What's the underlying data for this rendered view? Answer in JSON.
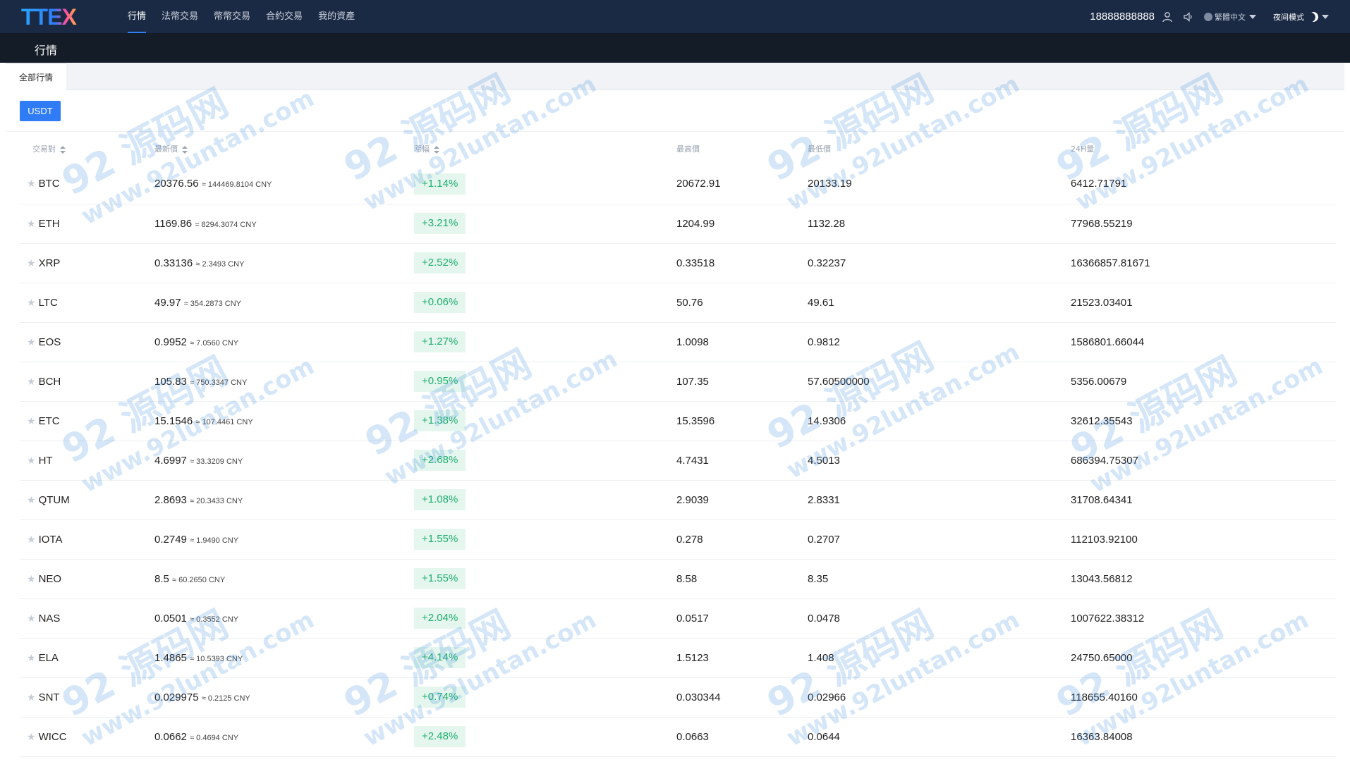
{
  "brand": {
    "logo_text": "TTEX"
  },
  "nav": {
    "items": [
      "行情",
      "法幣交易",
      "幣幣交易",
      "合約交易",
      "我的資產"
    ],
    "active_index": 0
  },
  "header": {
    "phone": "18888888888",
    "language": "繁體中文",
    "night_mode": "夜间模式"
  },
  "page": {
    "title": "行情",
    "tab_label": "全部行情",
    "filter_button": "USDT"
  },
  "table": {
    "headers": [
      "交易對",
      "最新價",
      "漲幅",
      "最高價",
      "最低價",
      "24H量"
    ],
    "rows": [
      {
        "pair": "BTC",
        "price": "20376.56",
        "cny": "≈ 144469.8104 CNY",
        "change": "+1.14%",
        "high": "20672.91",
        "low": "20133.19",
        "volume": "6412.71791"
      },
      {
        "pair": "ETH",
        "price": "1169.86",
        "cny": "≈ 8294.3074 CNY",
        "change": "+3.21%",
        "high": "1204.99",
        "low": "1132.28",
        "volume": "77968.55219"
      },
      {
        "pair": "XRP",
        "price": "0.33136",
        "cny": "≈ 2.3493 CNY",
        "change": "+2.52%",
        "high": "0.33518",
        "low": "0.32237",
        "volume": "16366857.81671"
      },
      {
        "pair": "LTC",
        "price": "49.97",
        "cny": "≈ 354.2873 CNY",
        "change": "+0.06%",
        "high": "50.76",
        "low": "49.61",
        "volume": "21523.03401"
      },
      {
        "pair": "EOS",
        "price": "0.9952",
        "cny": "≈ 7.0560 CNY",
        "change": "+1.27%",
        "high": "1.0098",
        "low": "0.9812",
        "volume": "1586801.66044"
      },
      {
        "pair": "BCH",
        "price": "105.83",
        "cny": "≈ 750.3347 CNY",
        "change": "+0.95%",
        "high": "107.35",
        "low": "57.60500000",
        "volume": "5356.00679"
      },
      {
        "pair": "ETC",
        "price": "15.1546",
        "cny": "≈ 107.4461 CNY",
        "change": "+1.38%",
        "high": "15.3596",
        "low": "14.9306",
        "volume": "32612.35543"
      },
      {
        "pair": "HT",
        "price": "4.6997",
        "cny": "≈ 33.3209 CNY",
        "change": "+2.68%",
        "high": "4.7431",
        "low": "4.5013",
        "volume": "686394.75307"
      },
      {
        "pair": "QTUM",
        "price": "2.8693",
        "cny": "≈ 20.3433 CNY",
        "change": "+1.08%",
        "high": "2.9039",
        "low": "2.8331",
        "volume": "31708.64341"
      },
      {
        "pair": "IOTA",
        "price": "0.2749",
        "cny": "≈ 1.9490 CNY",
        "change": "+1.55%",
        "high": "0.278",
        "low": "0.2707",
        "volume": "112103.92100"
      },
      {
        "pair": "NEO",
        "price": "8.5",
        "cny": "≈ 60.2650 CNY",
        "change": "+1.55%",
        "high": "8.58",
        "low": "8.35",
        "volume": "13043.56812"
      },
      {
        "pair": "NAS",
        "price": "0.0501",
        "cny": "≈ 0.3552 CNY",
        "change": "+2.04%",
        "high": "0.0517",
        "low": "0.0478",
        "volume": "1007622.38312"
      },
      {
        "pair": "ELA",
        "price": "1.4865",
        "cny": "≈ 10.5393 CNY",
        "change": "+4.14%",
        "high": "1.5123",
        "low": "1.408",
        "volume": "24750.65000"
      },
      {
        "pair": "SNT",
        "price": "0.029975",
        "cny": "≈ 0.2125 CNY",
        "change": "+0.74%",
        "high": "0.030344",
        "low": "0.02966",
        "volume": "118655.40160"
      },
      {
        "pair": "WICC",
        "price": "0.0662",
        "cny": "≈ 0.4694 CNY",
        "change": "+2.48%",
        "high": "0.0663",
        "low": "0.0644",
        "volume": "16363.84008"
      }
    ]
  },
  "watermark": {
    "big": "92 源码网",
    "small": "www.92luntan.com"
  },
  "colors": {
    "nav_bg": "#1b2a44",
    "sub_bg": "#141c27",
    "accent": "#2f7cf6",
    "up": "#1fae6f",
    "up_bg": "#e5f6ee"
  }
}
